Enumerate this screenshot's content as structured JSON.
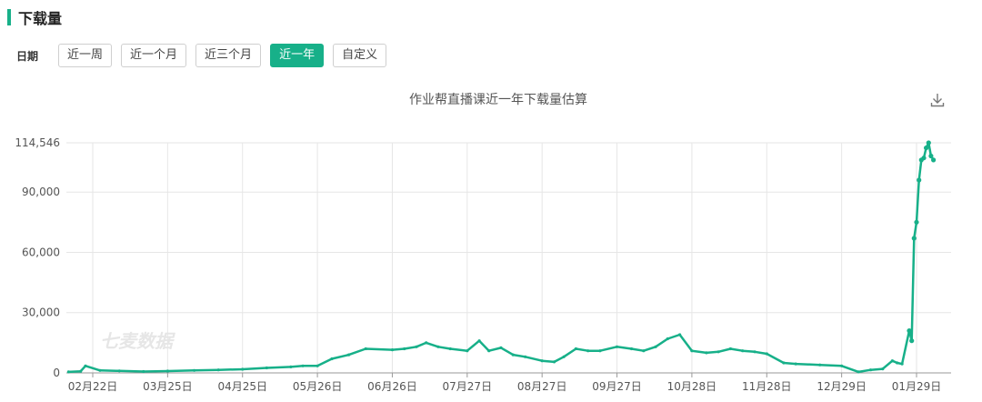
{
  "header": {
    "title": "下载量"
  },
  "filters": {
    "label": "日期",
    "options": [
      "近一周",
      "近一个月",
      "近三个月",
      "近一年",
      "自定义"
    ],
    "active_index": 3
  },
  "watermark": "七麦数据",
  "colors": {
    "accent": "#17b089",
    "line": "#17b089",
    "grid": "#e6e6e6"
  },
  "icons": {
    "download": "download-icon"
  },
  "chart_data": {
    "type": "line",
    "title": "作业帮直播课近一年下载量估算",
    "xlabel": "",
    "ylabel": "",
    "ylim": [
      0,
      114546
    ],
    "y_ticks": [
      0,
      30000,
      60000,
      90000,
      114546
    ],
    "y_tick_labels": [
      "0",
      "30,000",
      "60,000",
      "90,000",
      "114,546"
    ],
    "x_tick_labels": [
      "02月22日",
      "03月25日",
      "04月25日",
      "05月26日",
      "06月26日",
      "07月27日",
      "08月27日",
      "09月27日",
      "10月28日",
      "11月28日",
      "12月29日",
      "01月29日"
    ],
    "grid": true,
    "series": [
      {
        "name": "",
        "x": [
          "2023-02-12",
          "2023-02-17",
          "2023-02-19",
          "2023-02-25",
          "2023-03-05",
          "2023-03-15",
          "2023-03-25",
          "2023-04-05",
          "2023-04-15",
          "2023-04-25",
          "2023-05-05",
          "2023-05-15",
          "2023-05-20",
          "2023-05-26",
          "2023-06-01",
          "2023-06-08",
          "2023-06-15",
          "2023-06-26",
          "2023-07-01",
          "2023-07-06",
          "2023-07-10",
          "2023-07-15",
          "2023-07-20",
          "2023-07-27",
          "2023-08-01",
          "2023-08-05",
          "2023-08-10",
          "2023-08-15",
          "2023-08-20",
          "2023-08-27",
          "2023-09-01",
          "2023-09-05",
          "2023-09-10",
          "2023-09-15",
          "2023-09-20",
          "2023-09-27",
          "2023-10-03",
          "2023-10-08",
          "2023-10-13",
          "2023-10-18",
          "2023-10-23",
          "2023-10-28",
          "2023-11-03",
          "2023-11-08",
          "2023-11-13",
          "2023-11-18",
          "2023-11-23",
          "2023-11-28",
          "2023-12-05",
          "2023-12-10",
          "2023-12-20",
          "2023-12-29",
          "2024-01-05",
          "2024-01-10",
          "2024-01-15",
          "2024-01-19",
          "2024-01-21",
          "2024-01-23",
          "2024-01-26",
          "2024-01-27",
          "2024-01-28",
          "2024-01-29",
          "2024-01-30",
          "2024-01-31",
          "2024-02-01",
          "2024-02-02",
          "2024-02-03",
          "2024-02-04",
          "2024-02-05"
        ],
        "y": [
          500,
          800,
          3500,
          1200,
          1000,
          700,
          900,
          1200,
          1500,
          1800,
          2500,
          3000,
          3500,
          3500,
          7000,
          9000,
          12000,
          11500,
          12000,
          13000,
          15000,
          13000,
          12000,
          11000,
          16000,
          11000,
          12500,
          9000,
          8000,
          6000,
          5500,
          8000,
          12000,
          11000,
          11000,
          13000,
          12000,
          11000,
          13000,
          17000,
          19000,
          11000,
          10000,
          10500,
          12000,
          11000,
          10500,
          9500,
          5000,
          4500,
          4000,
          3500,
          500,
          1500,
          2000,
          6000,
          5000,
          4500,
          21000,
          16000,
          67000,
          75000,
          96000,
          106000,
          107000,
          112000,
          114546,
          108000,
          106000
        ]
      }
    ]
  }
}
